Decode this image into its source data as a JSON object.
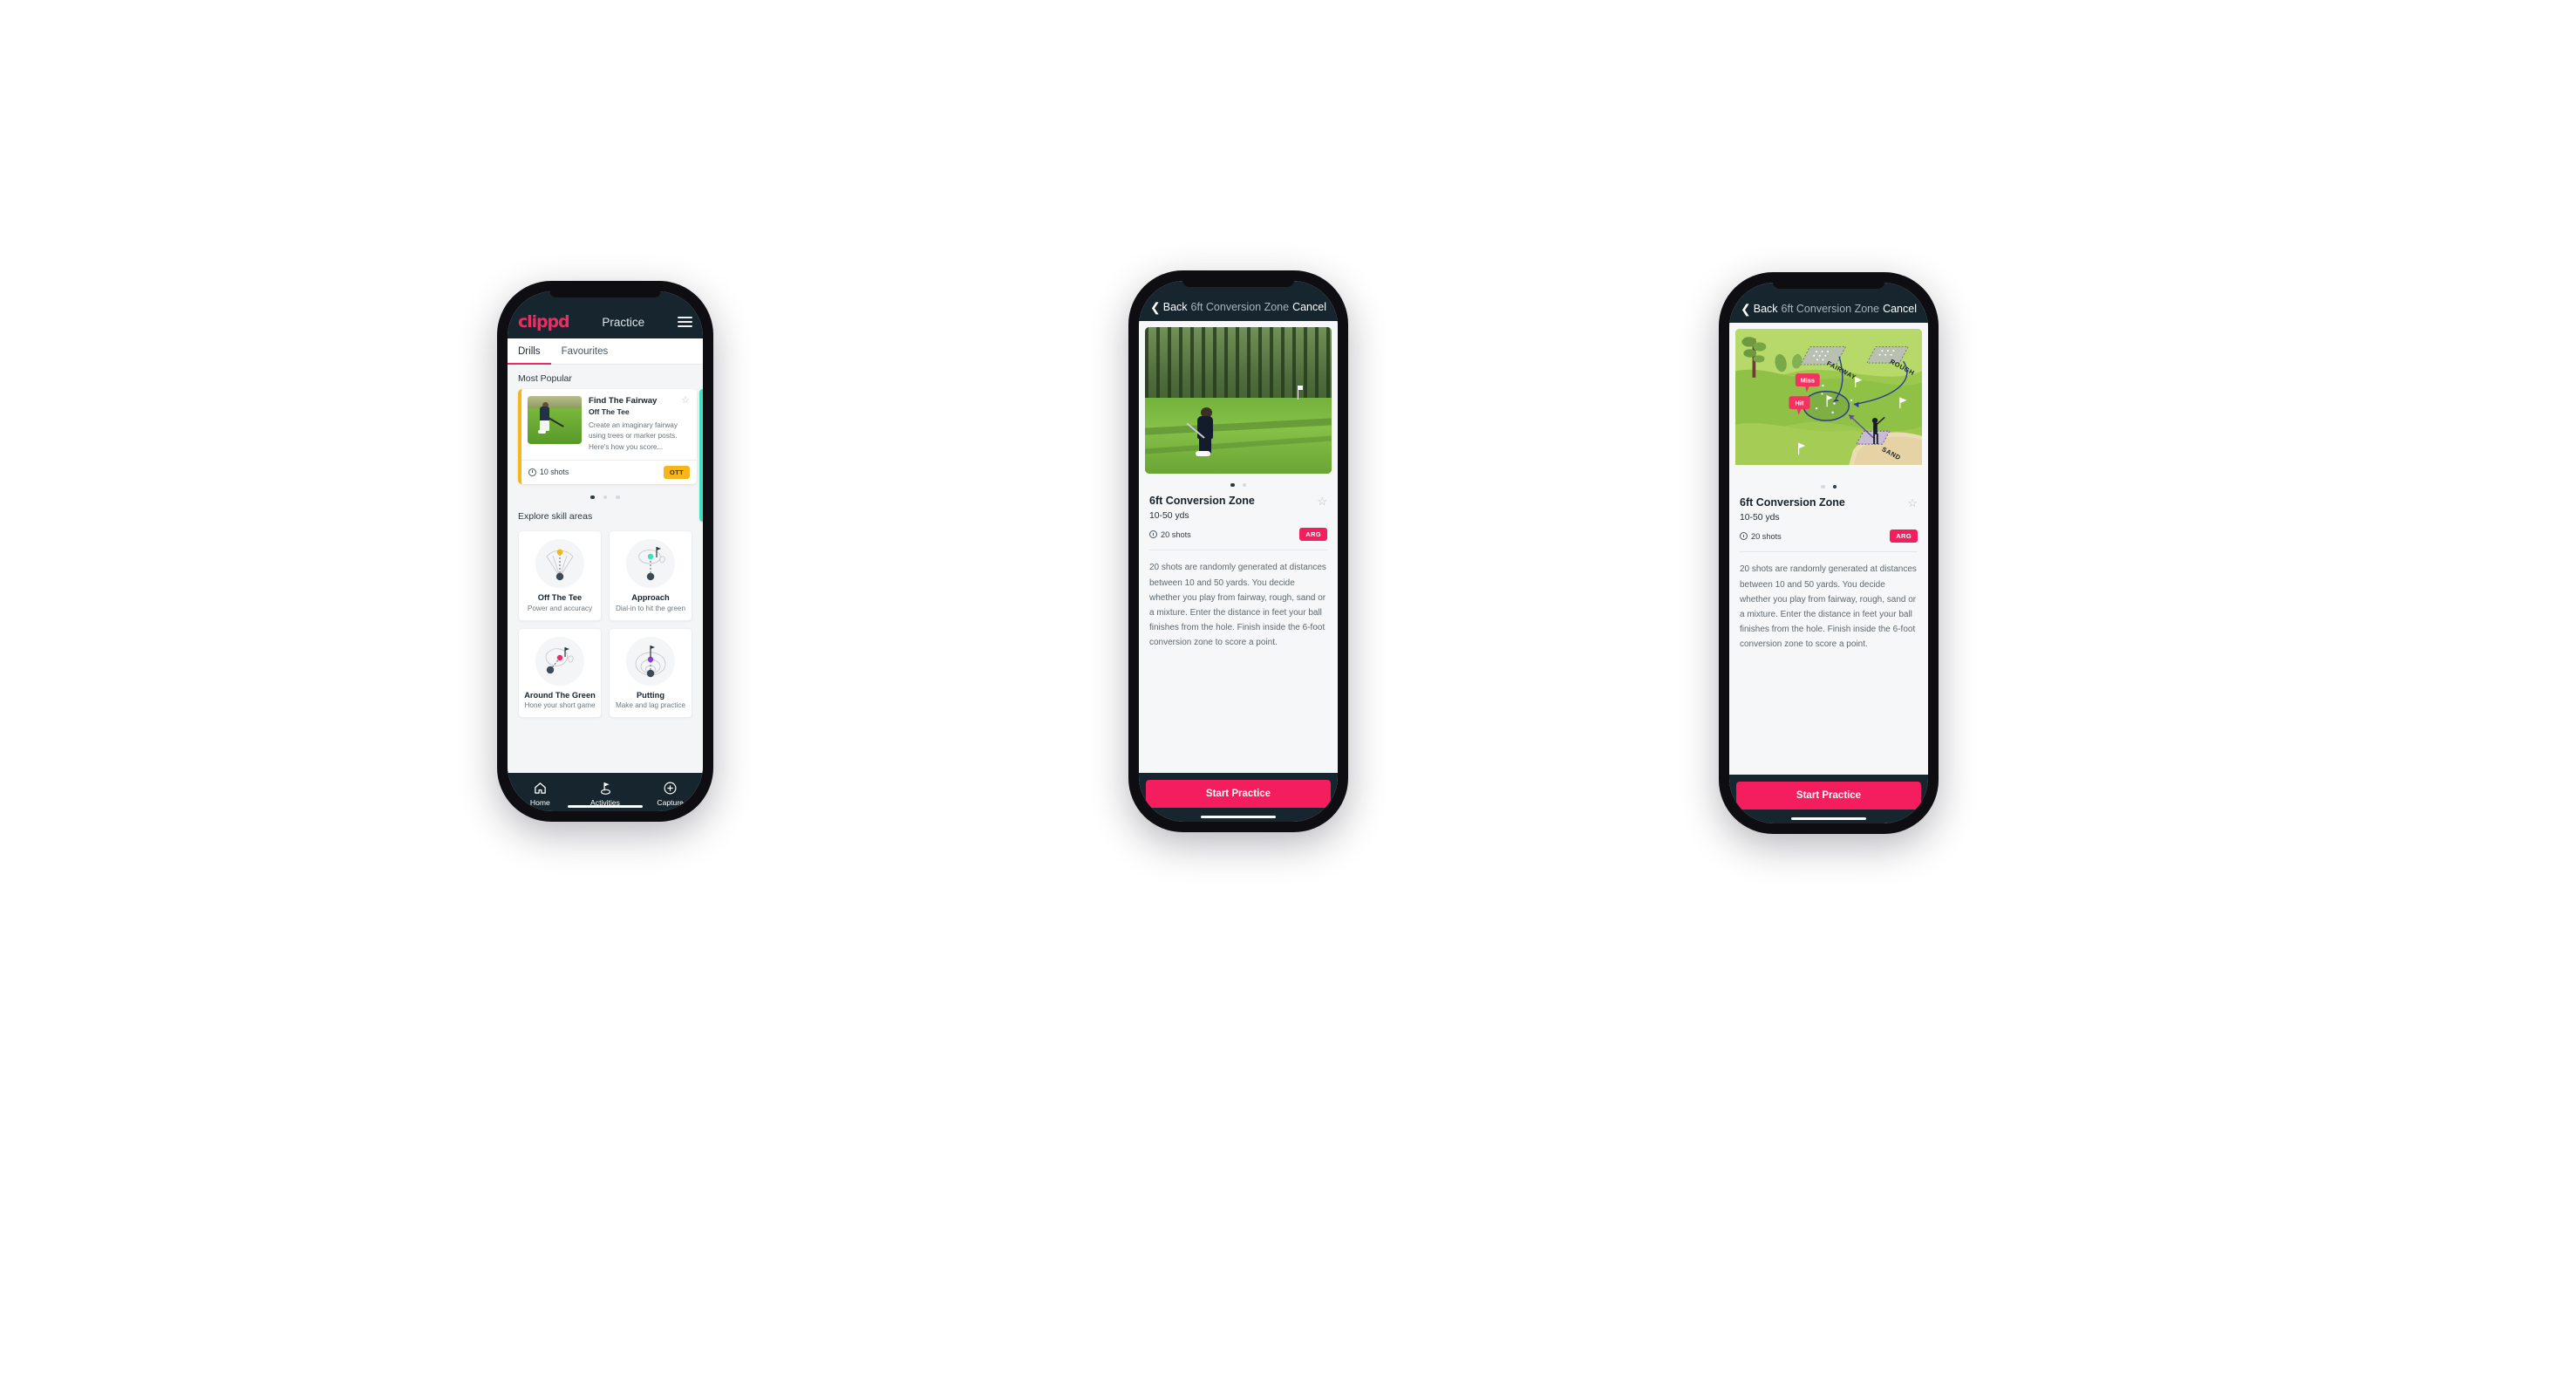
{
  "colors": {
    "brand_pink": "#ef2b63",
    "cta_pink": "#f41e5e",
    "dark_navy": "#16252e",
    "ott_yellow": "#f6b519",
    "arg_pink": "#f41e5e",
    "teal_accent": "#3ee0c0"
  },
  "phone_practice": {
    "appbar": {
      "logo": "clippd",
      "title": "Practice",
      "menu_icon": "hamburger-menu-icon"
    },
    "tabs": [
      {
        "label": "Drills",
        "active": true
      },
      {
        "label": "Favourites",
        "active": false
      }
    ],
    "most_popular": {
      "section_label": "Most Popular",
      "card": {
        "title": "Find The Fairway",
        "subtitle": "Off The Tee",
        "description": "Create an imaginary fairway using trees or marker posts. Here's how you score...",
        "shots": "10 shots",
        "badge": "OTT",
        "star_icon": "star-outline-icon",
        "clock_icon": "clock-icon",
        "thumbnail_icon": "golfer-teeing-off-photo"
      },
      "dots": [
        true,
        false,
        false
      ]
    },
    "explore": {
      "section_label": "Explore skill areas",
      "cards": [
        {
          "name": "Off The Tee",
          "desc": "Power and accuracy",
          "icon": "tee-shot-dispersion-icon",
          "accent": "#f6b519"
        },
        {
          "name": "Approach",
          "desc": "Dial-in to hit the green",
          "icon": "approach-green-icon",
          "accent": "#3ee0c0"
        },
        {
          "name": "Around The Green",
          "desc": "Hone your short game",
          "icon": "chip-around-green-icon",
          "accent": "#ef2b63"
        },
        {
          "name": "Putting",
          "desc": "Make and lag practice",
          "icon": "putting-rings-icon",
          "accent": "#8b3ed6"
        }
      ]
    },
    "bottom_nav": [
      {
        "label": "Home",
        "icon": "home-icon",
        "active": false
      },
      {
        "label": "Activities",
        "icon": "golf-flag-icon",
        "active": true
      },
      {
        "label": "Capture",
        "icon": "plus-circle-icon",
        "active": false
      }
    ]
  },
  "phone_detail_video": {
    "navbar": {
      "back_label": "Back",
      "back_icon": "chevron-left-icon",
      "title": "6ft Conversion Zone",
      "cancel_label": "Cancel"
    },
    "media": {
      "type": "photo",
      "alt": "golfer-chipping-on-course-photo"
    },
    "dots": [
      true,
      false
    ],
    "drill": {
      "title": "6ft Conversion Zone",
      "distance": "10-50 yds",
      "shots": "20 shots",
      "badge": "ARG",
      "star_icon": "star-outline-icon",
      "clock_icon": "clock-icon",
      "description": "20 shots are randomly generated at distances between 10 and 50 yards. You decide whether you play from fairway, rough, sand or a mixture. Enter the distance in feet your ball finishes from the hole. Finish inside the 6-foot conversion zone to score a point."
    },
    "cta": {
      "label": "Start Practice"
    }
  },
  "phone_detail_illustration": {
    "navbar": {
      "back_label": "Back",
      "back_icon": "chevron-left-icon",
      "title": "6ft Conversion Zone",
      "cancel_label": "Cancel"
    },
    "media": {
      "type": "illustration",
      "alt": "conversion-zone-course-diagram",
      "labels": [
        "FAIRWAY",
        "ROUGH",
        "SAND"
      ],
      "callouts": [
        "Miss",
        "Hit"
      ]
    },
    "dots": [
      false,
      true
    ],
    "drill": {
      "title": "6ft Conversion Zone",
      "distance": "10-50 yds",
      "shots": "20 shots",
      "badge": "ARG",
      "star_icon": "star-outline-icon",
      "clock_icon": "clock-icon",
      "description": "20 shots are randomly generated at distances between 10 and 50 yards. You decide whether you play from fairway, rough, sand or a mixture. Enter the distance in feet your ball finishes from the hole. Finish inside the 6-foot conversion zone to score a point."
    },
    "cta": {
      "label": "Start Practice"
    }
  }
}
